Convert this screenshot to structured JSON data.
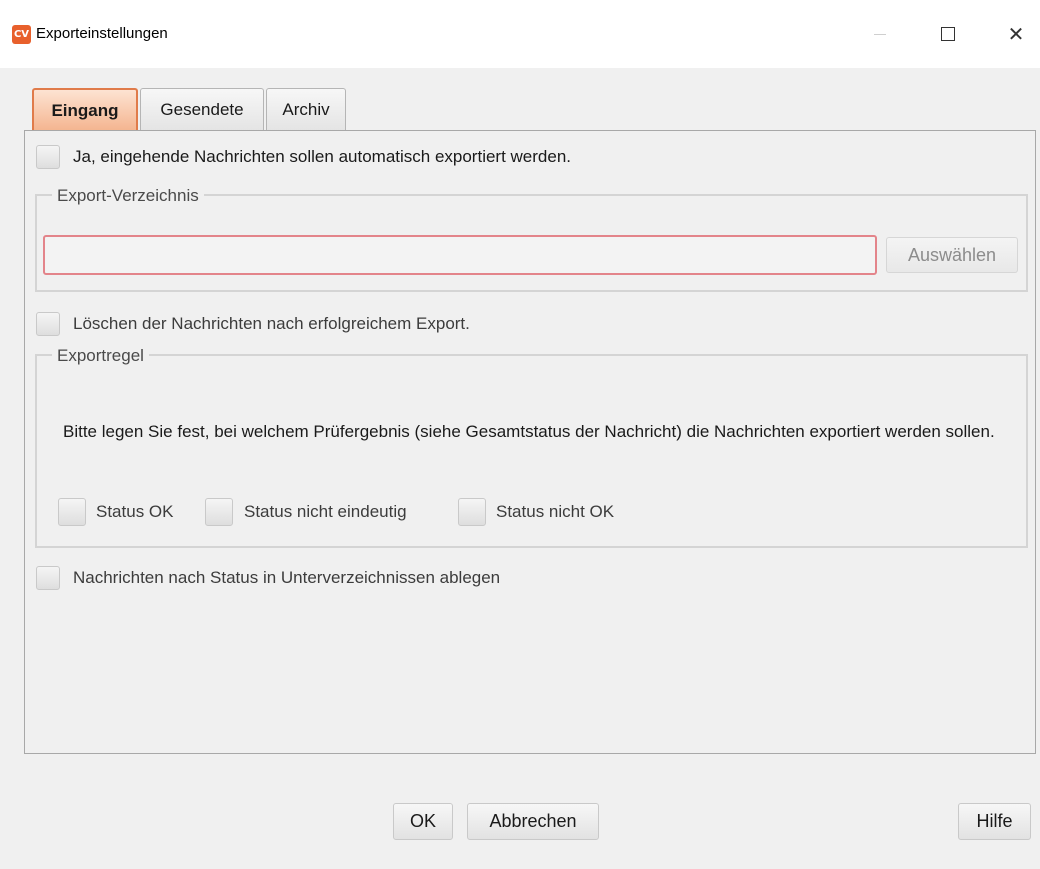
{
  "window": {
    "title": "Exporteinstellungen",
    "app_icon_text": "CV",
    "close_glyph": "✕"
  },
  "tabs": [
    {
      "label": "Eingang",
      "active": true
    },
    {
      "label": "Gesendete",
      "active": false
    },
    {
      "label": "Archiv",
      "active": false
    }
  ],
  "panel": {
    "auto_export_label": "Ja, eingehende Nachrichten sollen automatisch exportiert werden.",
    "export_dir": {
      "title": "Export-Verzeichnis",
      "value": "",
      "select_button": "Auswählen"
    },
    "delete_label": "Löschen der Nachrichten nach erfolgreichem Export.",
    "rule": {
      "title": "Exportregel",
      "description": "Bitte legen Sie fest, bei welchem Prüfergebnis (siehe Gesamtstatus der Nachricht) die Nachrichten exportiert werden sollen.",
      "status_ok": "Status OK",
      "status_unclear": "Status nicht eindeutig",
      "status_not_ok": "Status nicht OK"
    },
    "subdir_label": "Nachrichten nach Status in Unterverzeichnissen ablegen"
  },
  "buttons": {
    "ok": "OK",
    "cancel": "Abbrechen",
    "help": "Hilfe"
  },
  "colors": {
    "accent": "#e07b4a",
    "input_error_border": "#e3848a"
  }
}
